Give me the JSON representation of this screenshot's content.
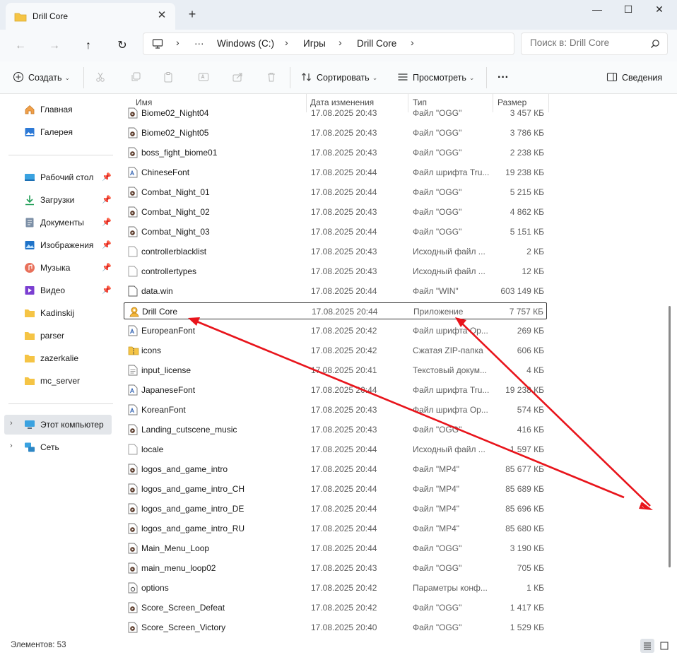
{
  "window": {
    "tab_title": "Drill Core",
    "new_tab": "+",
    "tab_close": "✕",
    "minimize": "—",
    "maximize": "☐",
    "close": "✕"
  },
  "address": {
    "ellipsis": "···",
    "crumbs": [
      "Windows (C:)",
      "Игры",
      "Drill Core"
    ],
    "separator": "›"
  },
  "search": {
    "placeholder": "Поиск в: Drill Core"
  },
  "toolbar": {
    "create_label": "Создать",
    "sort_label": "Сортировать",
    "view_label": "Просмотреть",
    "more_label": "···",
    "details_label": "Сведения"
  },
  "sidebar": {
    "items": [
      {
        "label": "Главная",
        "icon": "home-icon"
      },
      {
        "label": "Галерея",
        "icon": "gallery-icon"
      },
      {
        "label": "Рабочий стол",
        "icon": "desktop-icon",
        "pinned": true
      },
      {
        "label": "Загрузки",
        "icon": "download-icon",
        "pinned": true
      },
      {
        "label": "Документы",
        "icon": "documents-icon",
        "pinned": true
      },
      {
        "label": "Изображения",
        "icon": "pictures-icon",
        "pinned": true
      },
      {
        "label": "Музыка",
        "icon": "music-icon",
        "pinned": true
      },
      {
        "label": "Видео",
        "icon": "video-icon",
        "pinned": true
      },
      {
        "label": "Kadinskij",
        "icon": "folder-icon"
      },
      {
        "label": "parser",
        "icon": "folder-icon"
      },
      {
        "label": "zazerkalie",
        "icon": "folder-icon"
      },
      {
        "label": "mc_server",
        "icon": "folder-icon"
      },
      {
        "label": "Этот компьютер",
        "icon": "computer-icon",
        "selected": true
      },
      {
        "label": "Сеть",
        "icon": "network-icon"
      }
    ]
  },
  "columns": {
    "name": "Имя",
    "date": "Дата изменения",
    "type": "Тип",
    "size": "Размер"
  },
  "files": [
    {
      "name": "Biome02_Night04",
      "date": "17.08.2025 20:43",
      "type": "Файл \"OGG\"",
      "size": "3 457 КБ",
      "icon": "media"
    },
    {
      "name": "Biome02_Night05",
      "date": "17.08.2025 20:43",
      "type": "Файл \"OGG\"",
      "size": "3 786 КБ",
      "icon": "media"
    },
    {
      "name": "boss_fight_biome01",
      "date": "17.08.2025 20:43",
      "type": "Файл \"OGG\"",
      "size": "2 238 КБ",
      "icon": "media"
    },
    {
      "name": "ChineseFont",
      "date": "17.08.2025 20:44",
      "type": "Файл шрифта Tru...",
      "size": "19 238 КБ",
      "icon": "font"
    },
    {
      "name": "Combat_Night_01",
      "date": "17.08.2025 20:44",
      "type": "Файл \"OGG\"",
      "size": "5 215 КБ",
      "icon": "media"
    },
    {
      "name": "Combat_Night_02",
      "date": "17.08.2025 20:43",
      "type": "Файл \"OGG\"",
      "size": "4 862 КБ",
      "icon": "media"
    },
    {
      "name": "Combat_Night_03",
      "date": "17.08.2025 20:44",
      "type": "Файл \"OGG\"",
      "size": "5 151 КБ",
      "icon": "media"
    },
    {
      "name": "controllerblacklist",
      "date": "17.08.2025 20:43",
      "type": "Исходный файл ...",
      "size": "2 КБ",
      "icon": "doc"
    },
    {
      "name": "controllertypes",
      "date": "17.08.2025 20:43",
      "type": "Исходный файл ...",
      "size": "12 КБ",
      "icon": "doc"
    },
    {
      "name": "data.win",
      "date": "17.08.2025 20:44",
      "type": "Файл \"WIN\"",
      "size": "603 149 КБ",
      "icon": "blank"
    },
    {
      "name": "Drill Core",
      "date": "17.08.2025 20:44",
      "type": "Приложение",
      "size": "7 757 КБ",
      "icon": "app",
      "highlight": true
    },
    {
      "name": "EuropeanFont",
      "date": "17.08.2025 20:42",
      "type": "Файл шрифта Op...",
      "size": "269 КБ",
      "icon": "font"
    },
    {
      "name": "icons",
      "date": "17.08.2025 20:42",
      "type": "Сжатая ZIP-папка",
      "size": "606 КБ",
      "icon": "zip"
    },
    {
      "name": "input_license",
      "date": "17.08.2025 20:41",
      "type": "Текстовый докум...",
      "size": "4 КБ",
      "icon": "text"
    },
    {
      "name": "JapaneseFont",
      "date": "17.08.2025 20:44",
      "type": "Файл шрифта Tru...",
      "size": "19 238 КБ",
      "icon": "font"
    },
    {
      "name": "KoreanFont",
      "date": "17.08.2025 20:43",
      "type": "Файл шрифта Op...",
      "size": "574 КБ",
      "icon": "font"
    },
    {
      "name": "Landing_cutscene_music",
      "date": "17.08.2025 20:43",
      "type": "Файл \"OGG\"",
      "size": "416 КБ",
      "icon": "media"
    },
    {
      "name": "locale",
      "date": "17.08.2025 20:44",
      "type": "Исходный файл ...",
      "size": "1 597 КБ",
      "icon": "doc"
    },
    {
      "name": "logos_and_game_intro",
      "date": "17.08.2025 20:44",
      "type": "Файл \"MP4\"",
      "size": "85 677 КБ",
      "icon": "media"
    },
    {
      "name": "logos_and_game_intro_CH",
      "date": "17.08.2025 20:44",
      "type": "Файл \"MP4\"",
      "size": "85 689 КБ",
      "icon": "media"
    },
    {
      "name": "logos_and_game_intro_DE",
      "date": "17.08.2025 20:44",
      "type": "Файл \"MP4\"",
      "size": "85 696 КБ",
      "icon": "media"
    },
    {
      "name": "logos_and_game_intro_RU",
      "date": "17.08.2025 20:44",
      "type": "Файл \"MP4\"",
      "size": "85 680 КБ",
      "icon": "media"
    },
    {
      "name": "Main_Menu_Loop",
      "date": "17.08.2025 20:44",
      "type": "Файл \"OGG\"",
      "size": "3 190 КБ",
      "icon": "media"
    },
    {
      "name": "main_menu_loop02",
      "date": "17.08.2025 20:43",
      "type": "Файл \"OGG\"",
      "size": "705 КБ",
      "icon": "media"
    },
    {
      "name": "options",
      "date": "17.08.2025 20:42",
      "type": "Параметры конф...",
      "size": "1 КБ",
      "icon": "config"
    },
    {
      "name": "Score_Screen_Defeat",
      "date": "17.08.2025 20:42",
      "type": "Файл \"OGG\"",
      "size": "1 417 КБ",
      "icon": "media"
    },
    {
      "name": "Score_Screen_Victory",
      "date": "17.08.2025 20:40",
      "type": "Файл \"OGG\"",
      "size": "1 529 КБ",
      "icon": "media"
    }
  ],
  "status": {
    "count_text": "Элементов: 53"
  },
  "colors": {
    "accent": "#0067c0",
    "annotation_arrow": "#e8141b",
    "folder": "#f5c445"
  }
}
